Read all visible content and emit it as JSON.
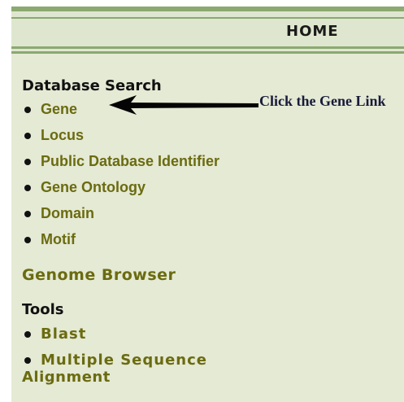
{
  "header": {
    "home_label": "HOME"
  },
  "database_search": {
    "heading": "Database Search",
    "items": [
      {
        "label": "Gene"
      },
      {
        "label": "Locus"
      },
      {
        "label": "Public Database Identifier"
      },
      {
        "label": "Gene Ontology"
      },
      {
        "label": "Domain"
      },
      {
        "label": "Motif"
      }
    ]
  },
  "genome_browser": {
    "label": "Genome Browser"
  },
  "tools": {
    "heading": "Tools",
    "items": [
      {
        "label": "Blast"
      },
      {
        "label": "Multiple Sequence"
      }
    ],
    "continuation": "Alignment"
  },
  "annotation": {
    "callout_text": "Click the Gene Link",
    "arrow_icon": "left-arrow-icon"
  },
  "colors": {
    "link": "#6b6b10",
    "background": "#e4ead4",
    "header_rule": "#8ba970"
  }
}
